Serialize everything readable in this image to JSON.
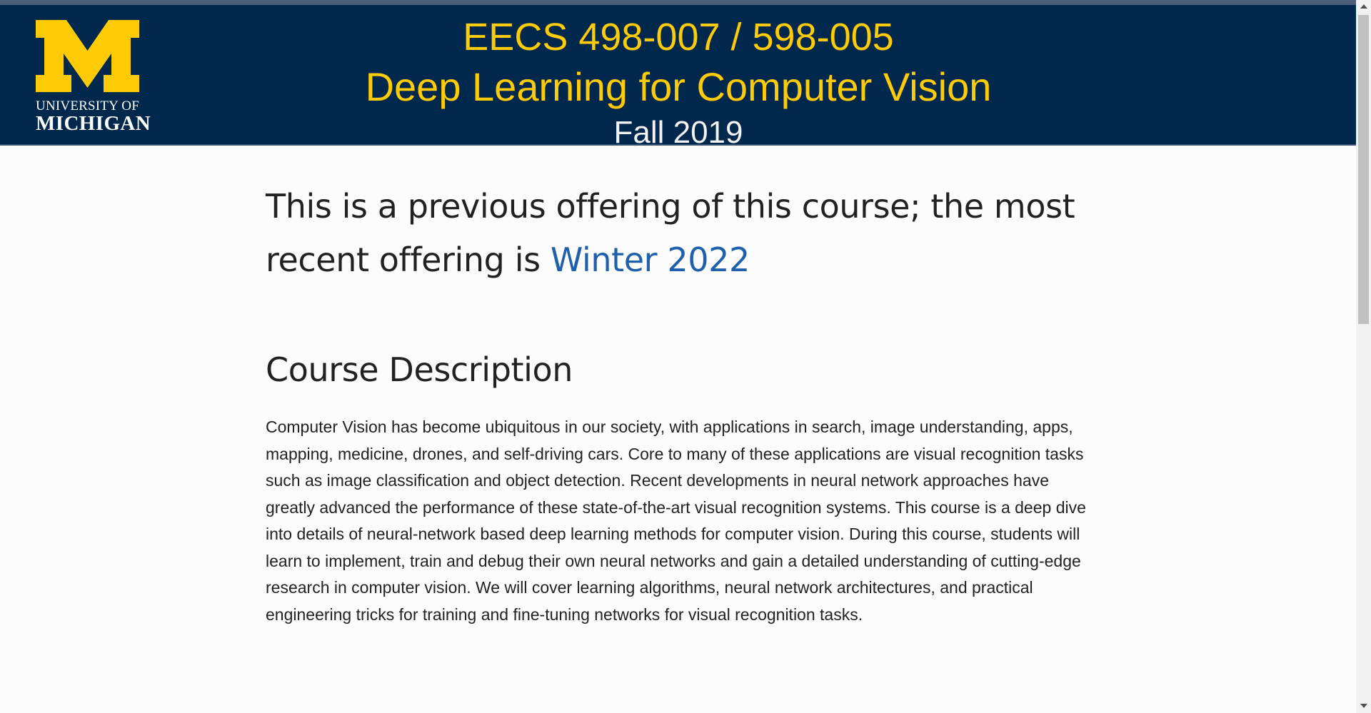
{
  "header": {
    "logo": {
      "icon": "block-m-icon",
      "line1": "UNIVERSITY OF",
      "line2": "MICHIGAN"
    },
    "course_number": "EECS 498-007 / 598-005",
    "course_title": "Deep Learning for Computer Vision",
    "term": "Fall 2019"
  },
  "notice": {
    "prefix": "This is a previous offering of this course; the most recent offering is ",
    "link_text": "Winter 2022"
  },
  "course_description": {
    "heading": "Course Description",
    "text": "Computer Vision has become ubiquitous in our society, with applications in search, image understanding, apps, mapping, medicine, drones, and self-driving cars. Core to many of these applications are visual recognition tasks such as image classification and object detection. Recent developments in neural network approaches have greatly advanced the performance of these state-of-the-art visual recognition systems. This course is a deep dive into details of neural-network based deep learning methods for computer vision. During this course, students will learn to implement, train and debug their own neural networks and gain a detailed understanding of cutting-edge research in computer vision. We will cover learning algorithms, neural network architectures, and practical engineering tricks for training and fine-tuning networks for visual recognition tasks."
  },
  "colors": {
    "header_bg": "#00274c",
    "maize": "#ffcb05",
    "link": "#1f5fab",
    "text": "#222222"
  }
}
